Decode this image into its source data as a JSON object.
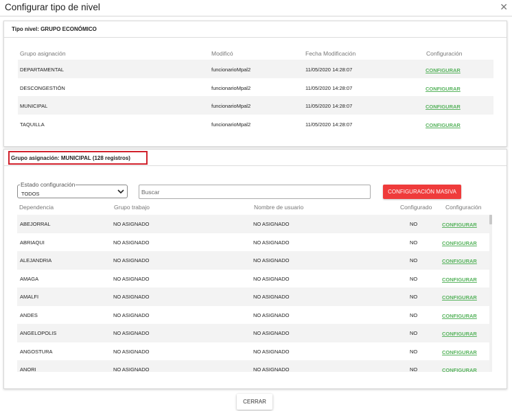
{
  "dialog": {
    "title": "Configurar tipo de nivel",
    "close_glyph": "✕"
  },
  "panel1": {
    "header": "Tipo nivel: GRUPO ECONÓMICO",
    "columns": [
      "Grupo asignación",
      "Modificó",
      "Fecha Modificación",
      "Configuración"
    ],
    "rows": [
      {
        "grupo": "DEPARTAMENTAL",
        "modifico": "funcionarioMpal2",
        "fecha": "11/05/2020 14:28:07",
        "accion": "CONFIGURAR"
      },
      {
        "grupo": "DESCONGESTIÓN",
        "modifico": "funcionarioMpal2",
        "fecha": "11/05/2020 14:28:07",
        "accion": "CONFIGURAR"
      },
      {
        "grupo": "MUNICIPAL",
        "modifico": "funcionarioMpal2",
        "fecha": "11/05/2020 14:28:07",
        "accion": "CONFIGURAR"
      },
      {
        "grupo": "TAQUILLA",
        "modifico": "funcionarioMpal2",
        "fecha": "11/05/2020 14:28:07",
        "accion": "CONFIGURAR"
      }
    ]
  },
  "panel2": {
    "header": "Grupo asignación: MUNICIPAL (128 registros)",
    "filter": {
      "label": "Estado configuración",
      "value": "TODOS"
    },
    "search": {
      "placeholder": "Buscar",
      "value": ""
    },
    "mass_button": "CONFIGURACIÓN MASIVA",
    "columns": [
      "Dependencia",
      "Grupo trabajo",
      "Nombre de usuario",
      "Configurado",
      "Configuración"
    ],
    "rows": [
      {
        "dependencia": "ABEJORRAL",
        "grupo": "NO ASIGNADO",
        "usuario": "NO ASIGNADO",
        "configurado": "NO",
        "accion": "CONFIGURAR"
      },
      {
        "dependencia": "ABRIAQUI",
        "grupo": "NO ASIGNADO",
        "usuario": "NO ASIGNADO",
        "configurado": "NO",
        "accion": "CONFIGURAR"
      },
      {
        "dependencia": "ALEJANDRIA",
        "grupo": "NO ASIGNADO",
        "usuario": "NO ASIGNADO",
        "configurado": "NO",
        "accion": "CONFIGURAR"
      },
      {
        "dependencia": "AMAGA",
        "grupo": "NO ASIGNADO",
        "usuario": "NO ASIGNADO",
        "configurado": "NO",
        "accion": "CONFIGURAR"
      },
      {
        "dependencia": "AMALFI",
        "grupo": "NO ASIGNADO",
        "usuario": "NO ASIGNADO",
        "configurado": "NO",
        "accion": "CONFIGURAR"
      },
      {
        "dependencia": "ANDES",
        "grupo": "NO ASIGNADO",
        "usuario": "NO ASIGNADO",
        "configurado": "NO",
        "accion": "CONFIGURAR"
      },
      {
        "dependencia": "ANGELOPOLIS",
        "grupo": "NO ASIGNADO",
        "usuario": "NO ASIGNADO",
        "configurado": "NO",
        "accion": "CONFIGURAR"
      },
      {
        "dependencia": "ANGOSTURA",
        "grupo": "NO ASIGNADO",
        "usuario": "NO ASIGNADO",
        "configurado": "NO",
        "accion": "CONFIGURAR"
      },
      {
        "dependencia": "ANORI",
        "grupo": "NO ASIGNADO",
        "usuario": "NO ASIGNADO",
        "configurado": "NO",
        "accion": "CONFIGURAR"
      }
    ]
  },
  "footer": {
    "close_label": "CERRAR"
  },
  "colors": {
    "link": "#57b35d",
    "primary_button": "#ef3b3b",
    "highlight_border": "#d0202a",
    "row_stripe": "#f3f3f3"
  }
}
